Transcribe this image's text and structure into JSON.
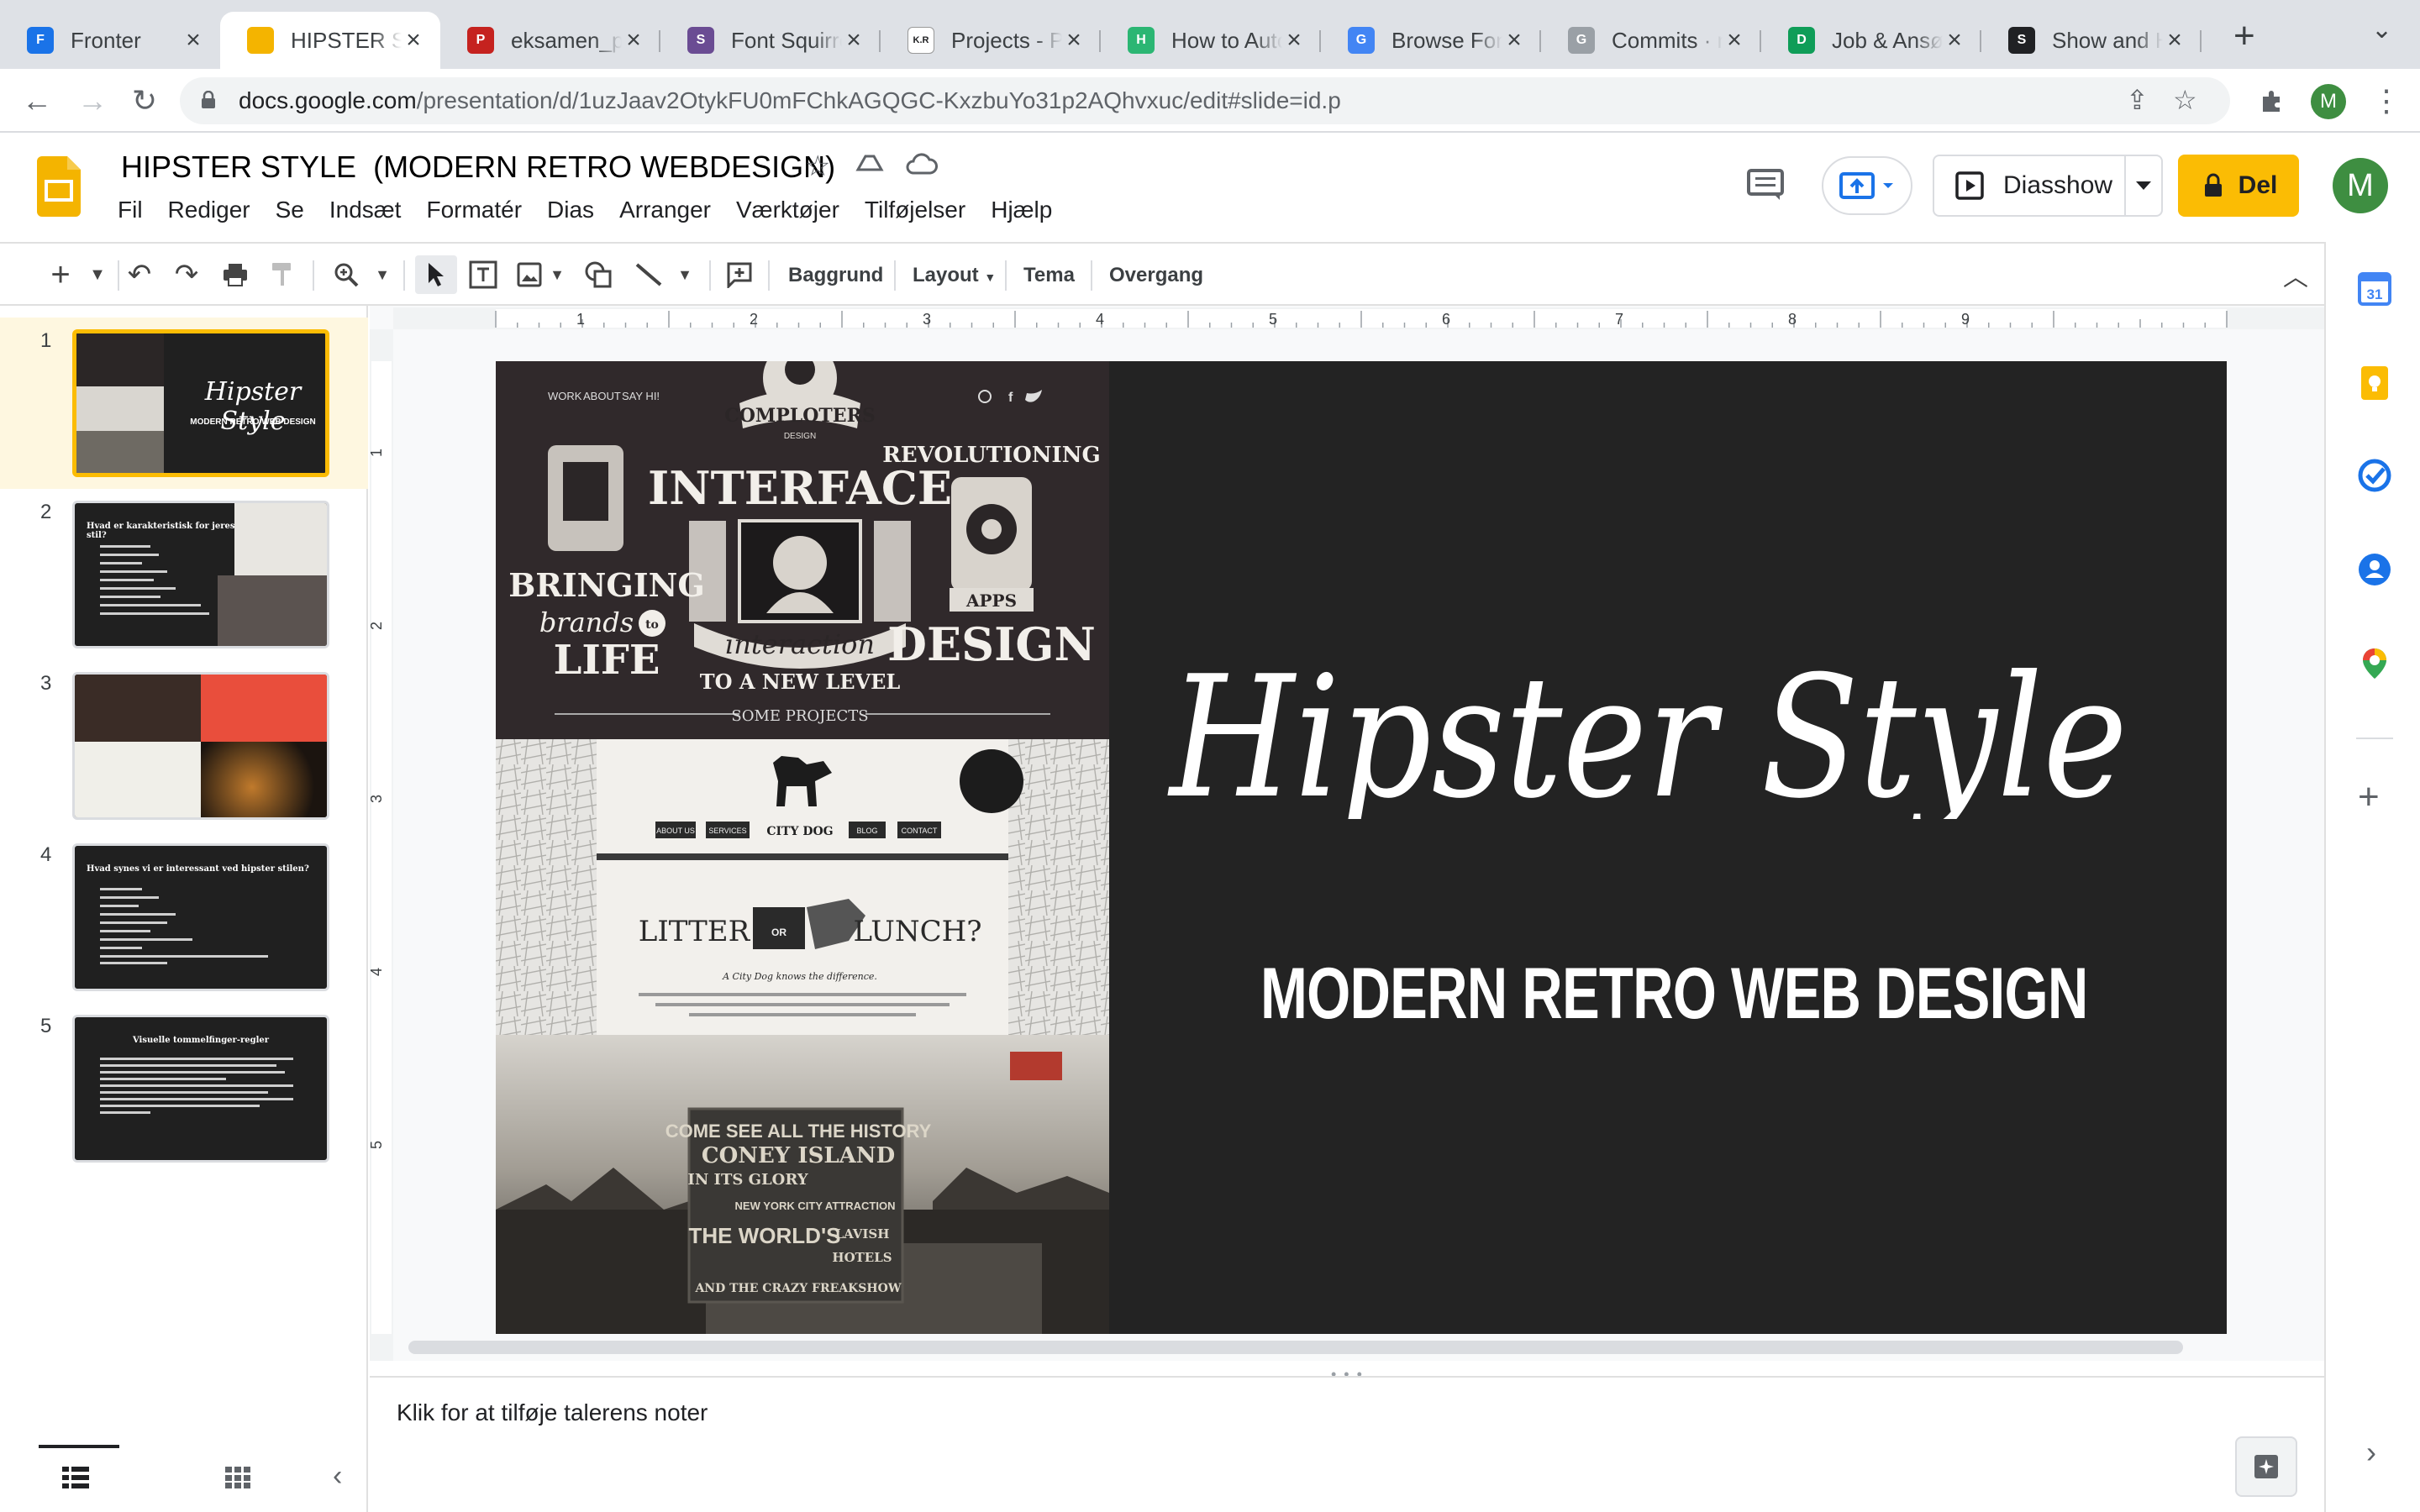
{
  "browser": {
    "tabs": [
      {
        "title": "Fronter",
        "favicon": "fronter-icon",
        "color": "#1a73e8",
        "glyph": "F"
      },
      {
        "title": "HIPSTER STYLE",
        "favicon": "slides-icon",
        "color": "#f4b400",
        "glyph": ""
      },
      {
        "title": "eksamen_p",
        "favicon": "docs-icon",
        "color": "#c5221f",
        "glyph": "P"
      },
      {
        "title": "Font Squirrel",
        "favicon": "squirrel-icon",
        "color": "#6a4c93",
        "glyph": "S"
      },
      {
        "title": "Projects - P",
        "favicon": "kr-icon",
        "color": "#ffffff",
        "glyph": "K.R"
      },
      {
        "title": "How to Auto",
        "favicon": "shield-icon",
        "color": "#2bb673",
        "glyph": "H"
      },
      {
        "title": "Browse Fon",
        "favicon": "google-fonts-icon",
        "color": "#4285f4",
        "glyph": "G"
      },
      {
        "title": "Commits · n",
        "favicon": "github-icon",
        "color": "#9aa0a6",
        "glyph": "G"
      },
      {
        "title": "Job & Ansø",
        "favicon": "drive-icon",
        "color": "#0f9d58",
        "glyph": "D"
      },
      {
        "title": "Show and H",
        "favicon": "square-icon",
        "color": "#202124",
        "glyph": "S"
      }
    ],
    "url_host": "docs.google.com",
    "url_path": "/presentation/d/1uzJaav2OtykFU0mFChkAGQGC-KxzbuYo31p2AQhvxuc/edit#slide=id.p",
    "profile_initial": "M"
  },
  "doc": {
    "title": "HIPSTER STYLE  (MODERN RETRO WEBDESIGN)",
    "menu": [
      "Fil",
      "Rediger",
      "Se",
      "Indsæt",
      "Formatér",
      "Dias",
      "Arranger",
      "Værktøjer",
      "Tilføjelser",
      "Hjælp"
    ],
    "slideshow_label": "Diasshow",
    "share_label": "Del",
    "avatar_initial": "M"
  },
  "toolbar": {
    "background": "Baggrund",
    "layout": "Layout",
    "theme": "Tema",
    "transition": "Overgang"
  },
  "ruler": {
    "h_ticks": [
      "1",
      "2",
      "3",
      "4",
      "5",
      "6",
      "7",
      "8",
      "9"
    ],
    "v_ticks": [
      "1",
      "2",
      "3",
      "4",
      "5"
    ]
  },
  "filmstrip": [
    {
      "num": "1",
      "title": "Hipster Style",
      "subtitle": "MODERN RETRO WEB DESIGN"
    },
    {
      "num": "2",
      "title": "Hvad er karakteristisk for jeres stil?"
    },
    {
      "num": "3",
      "title": ""
    },
    {
      "num": "4",
      "title": "Hvad synes vi er interessant ved hipster stilen?"
    },
    {
      "num": "5",
      "title": "Visuelle tommelfinger-regler"
    }
  ],
  "slide": {
    "title": "Hipster Style",
    "subtitle": "MODERN RETRO WEB DESIGN",
    "background": "#232323",
    "collage": {
      "nav": [
        "WORK",
        "ABOUT",
        "SAY HI!"
      ],
      "brand": "COMPLOTERS",
      "brand_sub": "DESIGN",
      "interface": "INTERFACE",
      "interaction": "interaction",
      "new_level": "TO A NEW LEVEL",
      "bringing": "BRINGING",
      "brands": "brands",
      "to": "to",
      "life": "LIFE",
      "revolutioning": "REVOLUTIONING",
      "apps": "APPS",
      "design": "DESIGN",
      "some_projects": "SOME PROJECTS",
      "dog_nav": [
        "ABOUT US",
        "SERVICES",
        "CITY DOG",
        "BLOG",
        "CONTACT"
      ],
      "litter": "LITTER",
      "or": "OR",
      "lunch": "LUNCH?",
      "tagline": "A City Dog knows the difference.",
      "coney_1": "COME SEE ALL THE HISTORY",
      "coney_2": "CONEY ISLAND",
      "coney_3": "IN ITS GLORY",
      "coney_4": "NEW YORK CITY ATTRACTION",
      "coney_5": "THE WORLD'S",
      "coney_6": "LAVISH",
      "coney_7": "HOTELS",
      "coney_8": "AND THE CRAZY FREAKSHOW"
    }
  },
  "notes": {
    "placeholder": "Klik for at tilføje talerens noter"
  }
}
